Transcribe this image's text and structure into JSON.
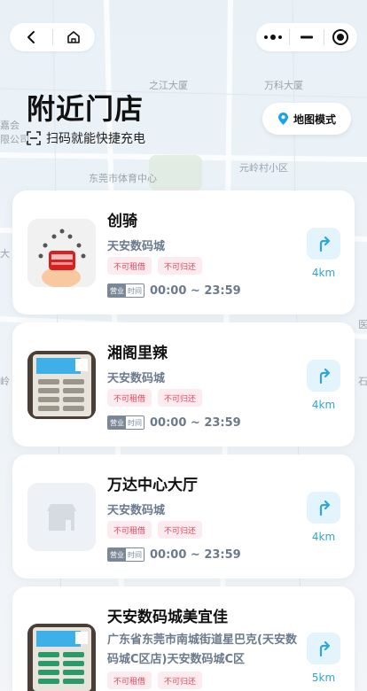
{
  "header": {
    "title": "附近门店",
    "subtitle": "扫码就能快捷充电",
    "map_mode_label": "地图模式"
  },
  "map_labels": [
    "之江大厦",
    "万科大厦",
    "嘉会",
    "限公司",
    "东莞市体育中心",
    "元岭村小区",
    "大",
    "医",
    "石",
    "岭"
  ],
  "stores": [
    {
      "name": "创骑",
      "address": "天安数码城",
      "tags": [
        "不可租借",
        "不可归还"
      ],
      "hours_badge_a": "营业",
      "hours_badge_b": "时间",
      "hours": "00:00 ~ 23:59",
      "distance": "4km",
      "thumb": "logo"
    },
    {
      "name": "湘阁里辣",
      "address": "天安数码城",
      "tags": [
        "不可租借",
        "不可归还"
      ],
      "hours_badge_a": "营业",
      "hours_badge_b": "时间",
      "hours": "00:00 ~ 23:59",
      "distance": "4km",
      "thumb": "device"
    },
    {
      "name": "万达中心大厅",
      "address": "天安数码城",
      "tags": [
        "不可租借",
        "不可归还"
      ],
      "hours_badge_a": "营业",
      "hours_badge_b": "时间",
      "hours": "00:00 ~ 23:59",
      "distance": "4km",
      "thumb": "placeholder"
    },
    {
      "name": "天安数码城美宜佳",
      "address": "广东省东莞市南城街道星巴克(天安数码城C区店)天安数码城C区",
      "address_line1": "广东省东莞市南城街道星巴克(天安数",
      "address_line2": "码城C区店)天安数码城C区",
      "tags": [
        "不可租借",
        "不可归还"
      ],
      "distance": "5km",
      "thumb": "device"
    }
  ],
  "colors": {
    "accent": "#2fa6d8",
    "tag_bg": "#fdecef",
    "tag_text": "#e5455c"
  }
}
